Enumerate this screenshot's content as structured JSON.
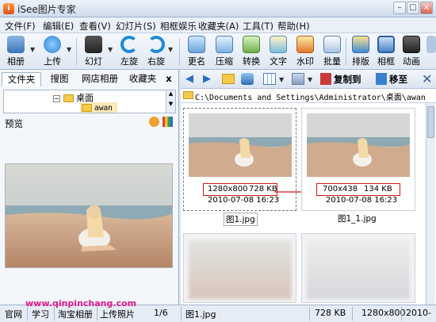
{
  "window": {
    "title": "iSee图片专家"
  },
  "menu": [
    "文件(F)",
    "编辑(E)",
    "查看(V)",
    "幻灯片(S)",
    "相框娱乐",
    "收藏夹(A)",
    "工具(T)",
    "帮助(H)"
  ],
  "toolbar": {
    "items": [
      {
        "label": "相册",
        "icon": "album-icon"
      },
      {
        "label": "上传",
        "icon": "upload-icon"
      },
      {
        "label": "幻灯",
        "icon": "slideshow-icon"
      },
      {
        "label": "左旋",
        "icon": "rotate-left-icon"
      },
      {
        "label": "右旋",
        "icon": "rotate-right-icon"
      },
      {
        "label": "更名",
        "icon": "rename-icon"
      },
      {
        "label": "压缩",
        "icon": "compress-icon"
      },
      {
        "label": "转换",
        "icon": "convert-icon"
      },
      {
        "label": "文字",
        "icon": "text-icon"
      },
      {
        "label": "水印",
        "icon": "watermark-icon"
      },
      {
        "label": "批量",
        "icon": "batch-icon"
      },
      {
        "label": "排版",
        "icon": "layout-icon"
      },
      {
        "label": "相框",
        "icon": "frame-icon"
      },
      {
        "label": "动画",
        "icon": "animation-icon"
      }
    ]
  },
  "left_panel": {
    "tabs": [
      "文件夹",
      "搜图",
      "网店相册",
      "收藏夹"
    ],
    "close": "x",
    "tree": [
      {
        "label": "桌面",
        "expand": "−"
      },
      {
        "label": "awan"
      }
    ],
    "preview_label": "预览"
  },
  "right_panel": {
    "copy_to": "复制到",
    "move_to": "移至",
    "path": "C:\\Documents and Settings\\Administrator\\桌面\\awan",
    "thumbnails": [
      {
        "dims": "1280x800",
        "size": "728 KB",
        "date": "2010-07-08 16:23",
        "filename": "图1.jpg"
      },
      {
        "dims": "700x438",
        "size": "134 KB",
        "date": "2010-07-08 16:23",
        "filename": "图1_1.jpg"
      }
    ]
  },
  "statusbar": {
    "tabs": [
      "官网",
      "学习",
      "淘宝相册",
      "上传照片"
    ],
    "page": "1/6",
    "filename": "图1.jpg",
    "size": "728 KB",
    "dims": "1280x800",
    "date": "2010-"
  },
  "watermark": "www.qinpinchang.com",
  "colors": {
    "accent_red": "#d41818",
    "watermark": "#e01a8a",
    "frame": "#dfe8f4"
  }
}
